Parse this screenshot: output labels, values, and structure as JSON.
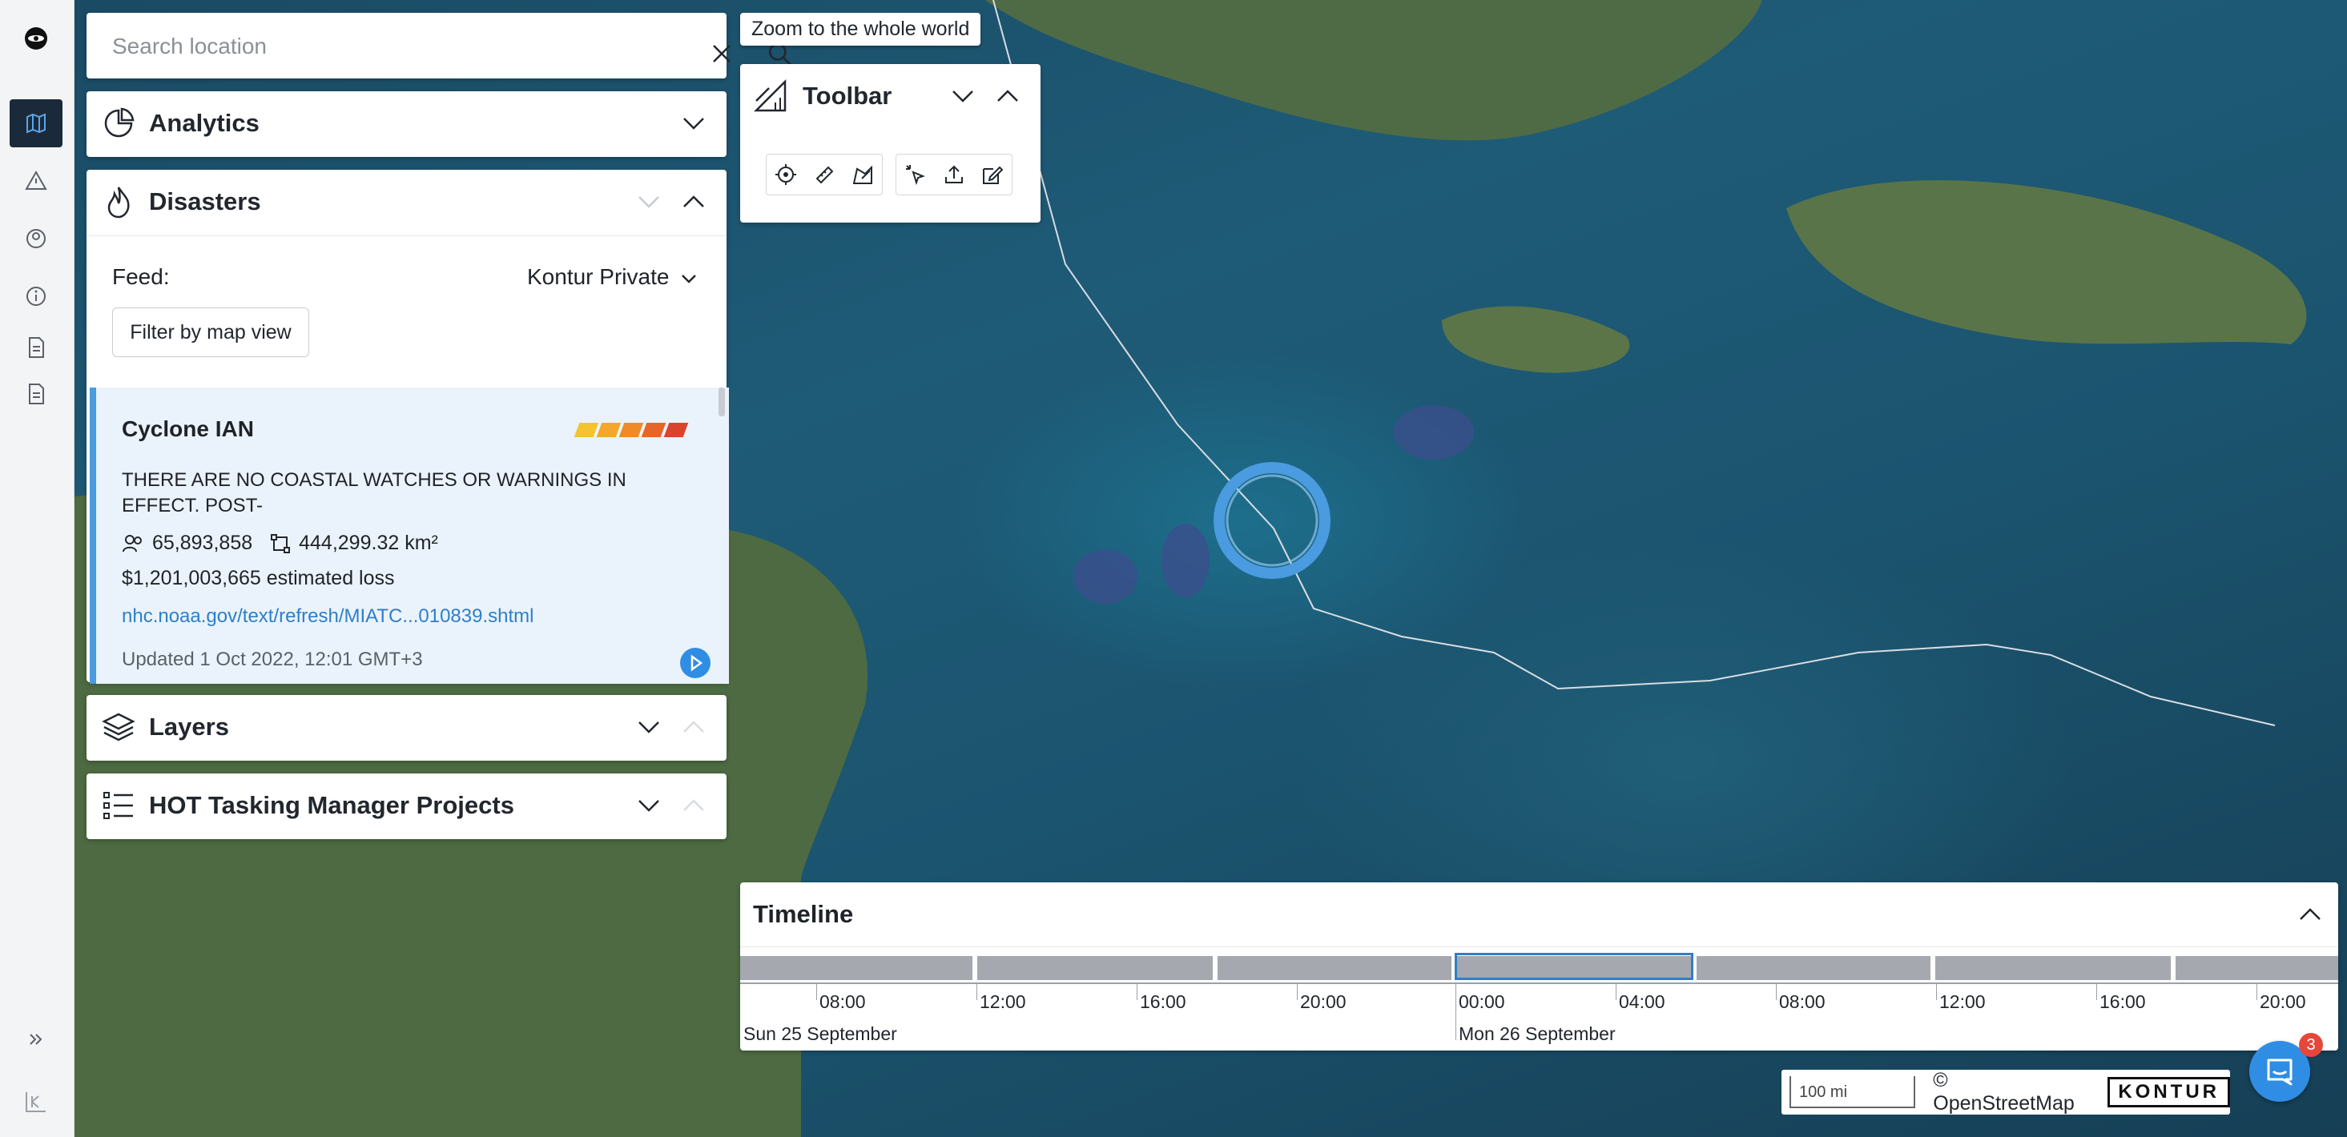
{
  "search": {
    "placeholder": "Search location"
  },
  "analytics": {
    "title": "Analytics"
  },
  "disasters": {
    "title": "Disasters",
    "feed_label": "Feed:",
    "feed_value": "Kontur Private",
    "filter_button": "Filter by map view",
    "event": {
      "title": "Cyclone IAN",
      "description": "THERE ARE NO COASTAL WATCHES OR WARNINGS IN EFFECT. POST-",
      "population": "65,893,858",
      "area": "444,299.32 km²",
      "loss": "$1,201,003,665 estimated loss",
      "link": "nhc.noaa.gov/text/refresh/MIATC...010839.shtml",
      "updated": "Updated 1 Oct 2022, 12:01 GMT+3",
      "severity_colors": [
        "#f4c430",
        "#f4a72c",
        "#f08a26",
        "#e8652a",
        "#d9452b"
      ]
    }
  },
  "layers": {
    "title": "Layers"
  },
  "hot": {
    "title": "HOT Tasking Manager Projects"
  },
  "toolbar": {
    "title": "Toolbar",
    "zoom_tooltip": "Zoom to the whole world"
  },
  "timeline": {
    "title": "Timeline",
    "hours": [
      "08:00",
      "12:00",
      "16:00",
      "20:00",
      "00:00",
      "04:00",
      "08:00",
      "12:00",
      "16:00",
      "20:00"
    ],
    "days": [
      "Sun 25 September",
      "Mon 26 September"
    ]
  },
  "attribution": {
    "scale": "100 mi",
    "osm": "© OpenStreetMap",
    "logo": "KONTUR"
  },
  "chat": {
    "badge": "3"
  },
  "colors": {
    "accent": "#2f7ec9",
    "sidebar_active": "#1b2a3a"
  }
}
